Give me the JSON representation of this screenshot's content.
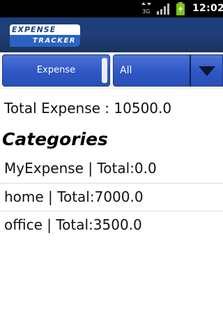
{
  "status_bar": {
    "network_label": "3G",
    "time": "12:02"
  },
  "app": {
    "logo_top": "EXPENSE",
    "logo_bottom": "TRACKER"
  },
  "controls": {
    "expense_button_label": "Expense",
    "filter_selected": "All"
  },
  "summary": {
    "total_text": "Total Expense : 10500.0"
  },
  "categories": {
    "heading": "Categories",
    "items": [
      {
        "label": "MyExpense | Total:0.0"
      },
      {
        "label": "home | Total:7000.0"
      },
      {
        "label": "office | Total:3500.0"
      }
    ]
  },
  "colors": {
    "title_bar": "#1c3e7a",
    "button_blue": "#2f57c4",
    "status_bar": "#000000",
    "battery_green": "#7ac70c"
  },
  "icons": {
    "signal": "signal-bars-icon",
    "battery": "battery-charging-icon",
    "dropdown": "dropdown-triangle-icon",
    "network": "network-activity-icon"
  }
}
